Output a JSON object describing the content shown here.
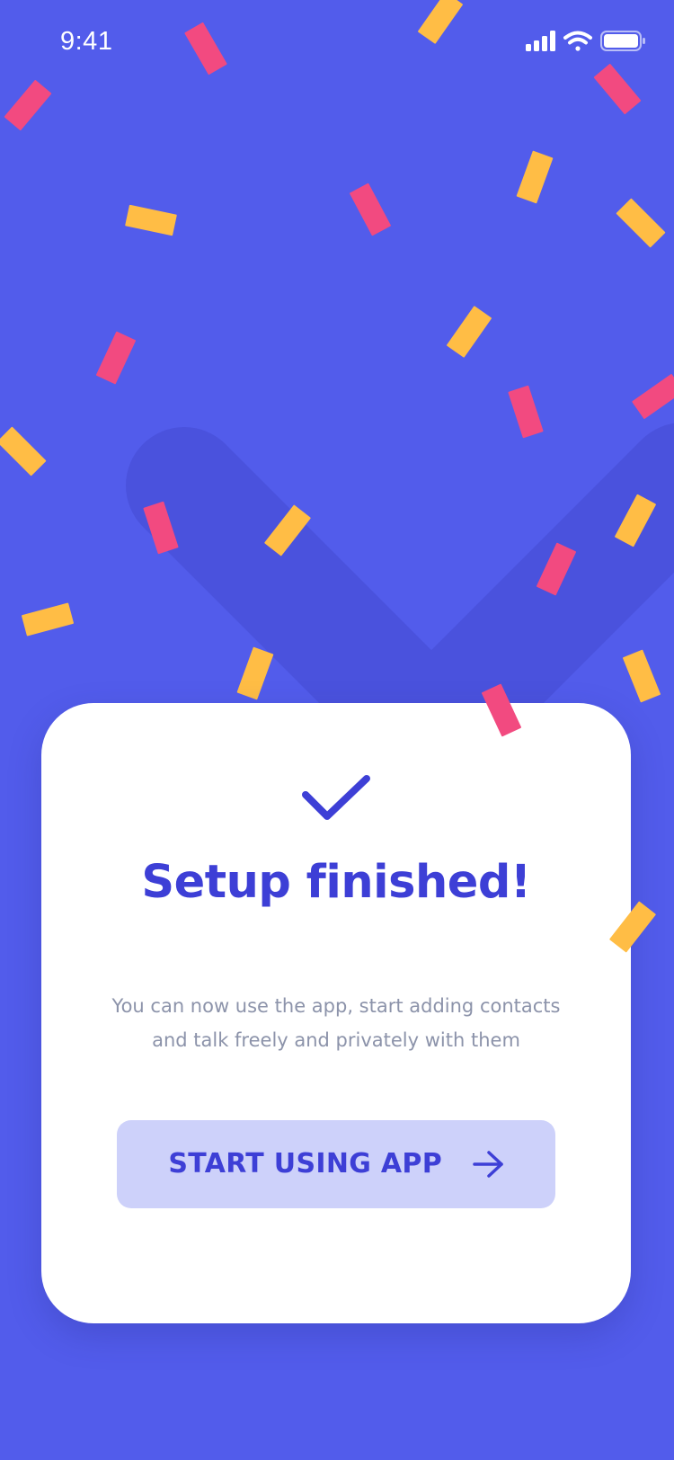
{
  "status_bar": {
    "time": "9:41",
    "icons": [
      "cellular-signal-icon",
      "wifi-icon",
      "battery-icon"
    ]
  },
  "colors": {
    "background": "#525CEB",
    "accent": "#3D3FD6",
    "button_background": "#CDD1FA",
    "subtitle_text": "#8C93AA",
    "confetti_pink": "#F24A80",
    "confetti_yellow": "#FFBD45"
  },
  "card": {
    "icon": "checkmark-icon",
    "title": "Setup finished!",
    "subtitle_line1": "You can now use the app, start adding contacts",
    "subtitle_line2": "and talk freely and privately with them",
    "button": {
      "label": "START USING APP",
      "icon": "arrow-right-icon"
    }
  }
}
